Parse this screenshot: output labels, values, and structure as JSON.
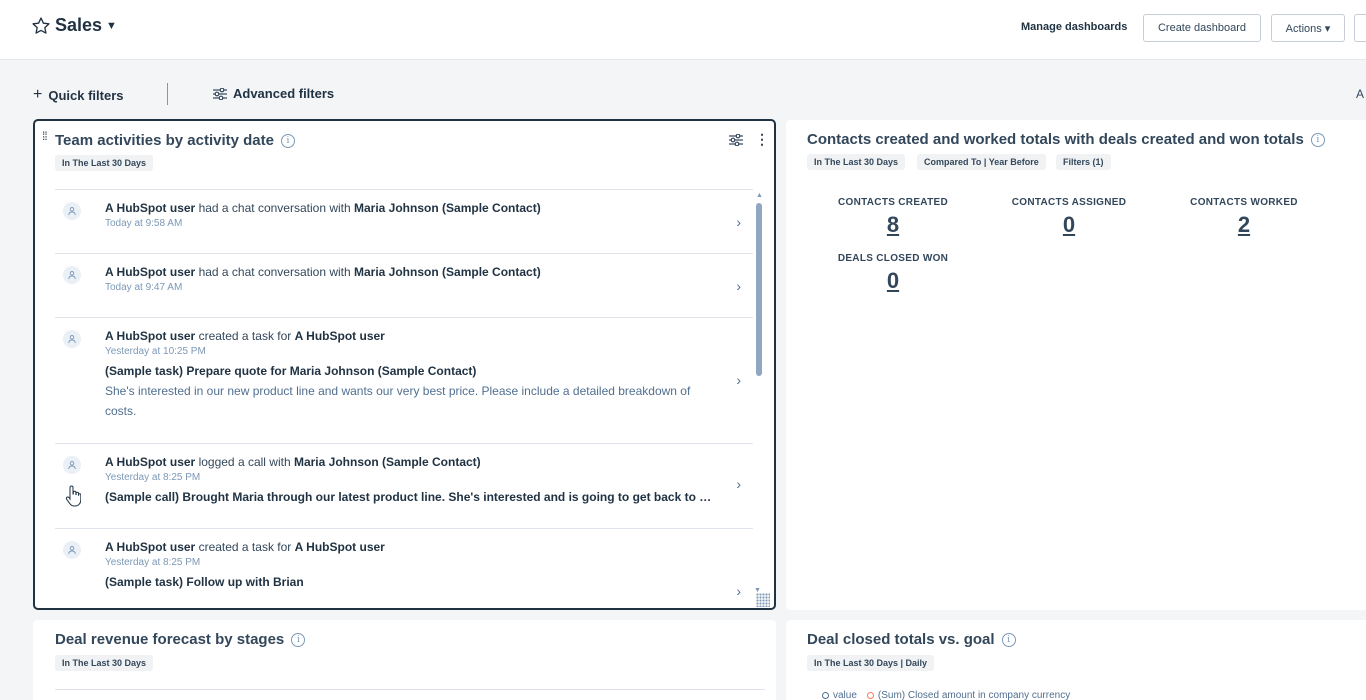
{
  "header": {
    "title": "Sales",
    "manage_label": "Manage dashboards",
    "create_label": "Create dashboard",
    "actions_label": "Actions ▾"
  },
  "filters": {
    "quick_label": "Quick filters",
    "advanced_label": "Advanced filters",
    "edge_text": "A"
  },
  "team_card": {
    "title": "Team activities by activity date",
    "tag": "In The Last 30 Days",
    "activities": [
      {
        "actor": "A HubSpot user",
        "action": " had a chat conversation with ",
        "target": "Maria Johnson (Sample Contact)",
        "time": "Today at 9:58 AM"
      },
      {
        "actor": "A HubSpot user",
        "action": " had a chat conversation with ",
        "target": "Maria Johnson (Sample Contact)",
        "time": "Today at 9:47 AM"
      },
      {
        "actor": "A HubSpot user",
        "action": " created a task for ",
        "target": "A HubSpot user",
        "time": "Yesterday at 10:25 PM",
        "subject": "(Sample task) Prepare quote for Maria Johnson (Sample Contact)",
        "description": "She's interested in our new product line and wants our very best price. Please include a detailed breakdown of costs."
      },
      {
        "actor": "A HubSpot user",
        "action": " logged a call with ",
        "target": "Maria Johnson (Sample Contact)",
        "time": "Yesterday at 8:25 PM",
        "subject": "(Sample call) Brought Maria through our latest product line. She's interested and is going to get back to me"
      },
      {
        "actor": "A HubSpot user",
        "action": " created a task for ",
        "target": "A HubSpot user",
        "time": "Yesterday at 8:25 PM",
        "subject": "(Sample task) Follow up with Brian"
      }
    ]
  },
  "contacts_card": {
    "title": "Contacts created and worked totals with deals created and won totals",
    "tags": [
      "In The Last 30 Days",
      "Compared To | Year Before",
      "Filters (1)"
    ],
    "stats": [
      {
        "label": "CONTACTS CREATED",
        "value": "8"
      },
      {
        "label": "CONTACTS ASSIGNED",
        "value": "0"
      },
      {
        "label": "CONTACTS WORKED",
        "value": "2"
      },
      {
        "label": "DEALS CLOSED WON",
        "value": "0"
      }
    ]
  },
  "forecast_card": {
    "title": "Deal revenue forecast by stages",
    "tag": "In The Last 30 Days"
  },
  "closed_card": {
    "title": "Deal closed totals vs. goal",
    "tag": "In The Last 30 Days | Daily",
    "legend": [
      "value",
      "(Sum) Closed amount in company currency"
    ]
  },
  "colors": {
    "text": "#33475b",
    "dark": "#213343",
    "border": "#dfe3eb",
    "accent": "#ff7a59"
  }
}
